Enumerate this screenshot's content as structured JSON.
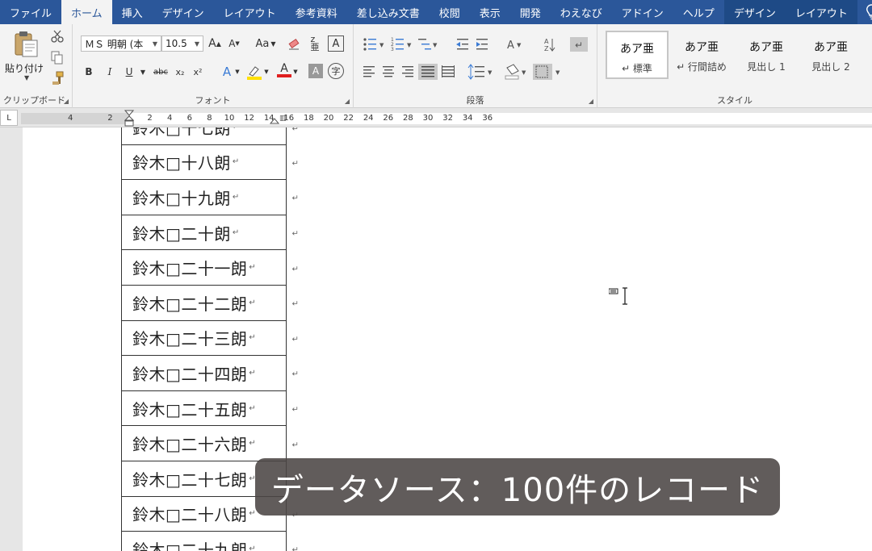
{
  "ribbon_tabs": [
    {
      "label": "ファイル"
    },
    {
      "label": "ホーム"
    },
    {
      "label": "挿入"
    },
    {
      "label": "デザイン"
    },
    {
      "label": "レイアウト"
    },
    {
      "label": "参考資料"
    },
    {
      "label": "差し込み文書"
    },
    {
      "label": "校閲"
    },
    {
      "label": "表示"
    },
    {
      "label": "開発"
    },
    {
      "label": "わえなび"
    },
    {
      "label": "アドイン"
    },
    {
      "label": "ヘルプ"
    },
    {
      "label": "デザイン"
    },
    {
      "label": "レイアウト"
    }
  ],
  "active_tab": "ホーム",
  "clipboard": {
    "paste_label": "貼り付け",
    "group_label": "クリップボード"
  },
  "font": {
    "font_name": "ＭＳ 明朝 (本",
    "font_size": "10.5",
    "grow_label": "A",
    "shrink_label": "A",
    "case_label": "Aa",
    "bold": "B",
    "italic": "I",
    "underline": "U",
    "strike": "abc",
    "subscript": "x₂",
    "superscript": "x²",
    "group_label": "フォント"
  },
  "paragraph": {
    "group_label": "段落"
  },
  "styles": {
    "items": [
      {
        "sample": "あア亜",
        "name": "↵ 標準"
      },
      {
        "sample": "あア亜",
        "name": "↵ 行間詰め"
      },
      {
        "sample": "あア亜",
        "name": "見出し 1"
      },
      {
        "sample": "あア亜",
        "name": "見出し 2"
      }
    ],
    "group_label": "スタイル"
  },
  "ruler": {
    "corner": "L",
    "ticks": [
      "4",
      "2",
      "2",
      "4",
      "6",
      "8",
      "10",
      "12",
      "14",
      "16",
      "18",
      "20",
      "22",
      "24",
      "26",
      "28",
      "30",
      "32",
      "34",
      "36"
    ]
  },
  "table_rows": [
    {
      "text": "鈴木□十七朗"
    },
    {
      "text": "鈴木□十八朗"
    },
    {
      "text": "鈴木□十九朗"
    },
    {
      "text": "鈴木□二十朗"
    },
    {
      "text": "鈴木□二十一朗"
    },
    {
      "text": "鈴木□二十二朗"
    },
    {
      "text": "鈴木□二十三朗"
    },
    {
      "text": "鈴木□二十四朗"
    },
    {
      "text": "鈴木□二十五朗"
    },
    {
      "text": "鈴木□二十六朗"
    },
    {
      "text": "鈴木□二十七朗"
    },
    {
      "text": "鈴木□二十八朗"
    },
    {
      "text": "鈴木□二十九朗"
    }
  ],
  "mark": "↵",
  "caption": "データソース：100件のレコード",
  "colors": {
    "ribbon_blue": "#2b579a",
    "font_color_red": "#e02020",
    "highlight_yellow": "#ffe000"
  }
}
